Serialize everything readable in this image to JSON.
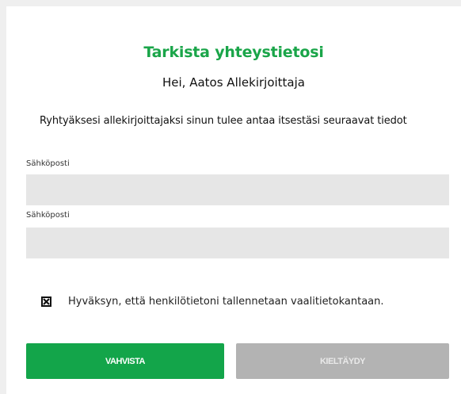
{
  "form": {
    "title": "Tarkista yhteystietosi",
    "greeting": "Hei, Aatos Allekirjoittaja",
    "intro": "Ryhtyäksesi allekirjoittajaksi sinun tulee antaa itsestäsi seuraavat tiedot",
    "fields": [
      {
        "label": "Sähköposti",
        "value": ""
      },
      {
        "label": "Sähköposti",
        "value": ""
      }
    ],
    "consent": {
      "checked": true,
      "text": "Hyväksyn, että henkilötietoni tallennetaan vaalitietokantaan."
    },
    "buttons": {
      "confirm": "VAHVISTA",
      "decline": "KIELTÄYDY"
    }
  },
  "colors": {
    "accent": "#1aa549",
    "confirm_bg": "#13a54a",
    "decline_bg": "#b3b3b3",
    "input_bg": "#e6e6e6"
  }
}
